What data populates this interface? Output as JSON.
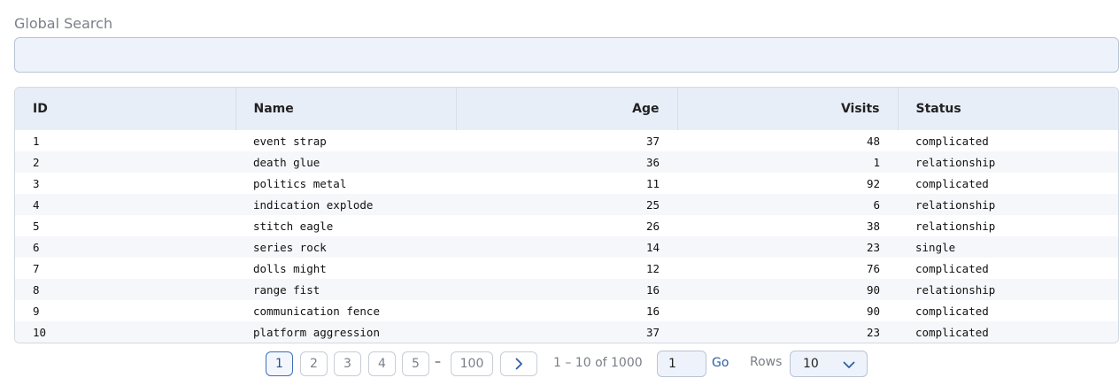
{
  "search": {
    "label": "Global Search",
    "value": "",
    "placeholder": ""
  },
  "table": {
    "columns": [
      "ID",
      "Name",
      "Age",
      "Visits",
      "Status"
    ],
    "rows": [
      [
        "1",
        "event strap",
        "37",
        "48",
        "complicated"
      ],
      [
        "2",
        "death glue",
        "36",
        "1",
        "relationship"
      ],
      [
        "3",
        "politics metal",
        "11",
        "92",
        "complicated"
      ],
      [
        "4",
        "indication explode",
        "25",
        "6",
        "relationship"
      ],
      [
        "5",
        "stitch eagle",
        "26",
        "38",
        "relationship"
      ],
      [
        "6",
        "series rock",
        "14",
        "23",
        "single"
      ],
      [
        "7",
        "dolls might",
        "12",
        "76",
        "complicated"
      ],
      [
        "8",
        "range fist",
        "16",
        "90",
        "relationship"
      ],
      [
        "9",
        "communication fence",
        "16",
        "90",
        "complicated"
      ],
      [
        "10",
        "platform aggression",
        "37",
        "23",
        "complicated"
      ]
    ]
  },
  "pagination": {
    "pages": [
      "1",
      "2",
      "3",
      "4",
      "5"
    ],
    "active_page": "1",
    "ellipsis": "–",
    "last_page": "100",
    "range_text": "1 – 10 of 1000",
    "go_value": "1",
    "go_label": "Go",
    "rows_label": "Rows",
    "rows_value": "10",
    "next_icon": "chevron-right-icon",
    "rows_icon": "chevron-down-icon"
  },
  "colors": {
    "accent": "#3d6fb6",
    "link": "#2c5fa6",
    "header_bg": "#e8eef8",
    "input_bg": "#eef3fb"
  }
}
